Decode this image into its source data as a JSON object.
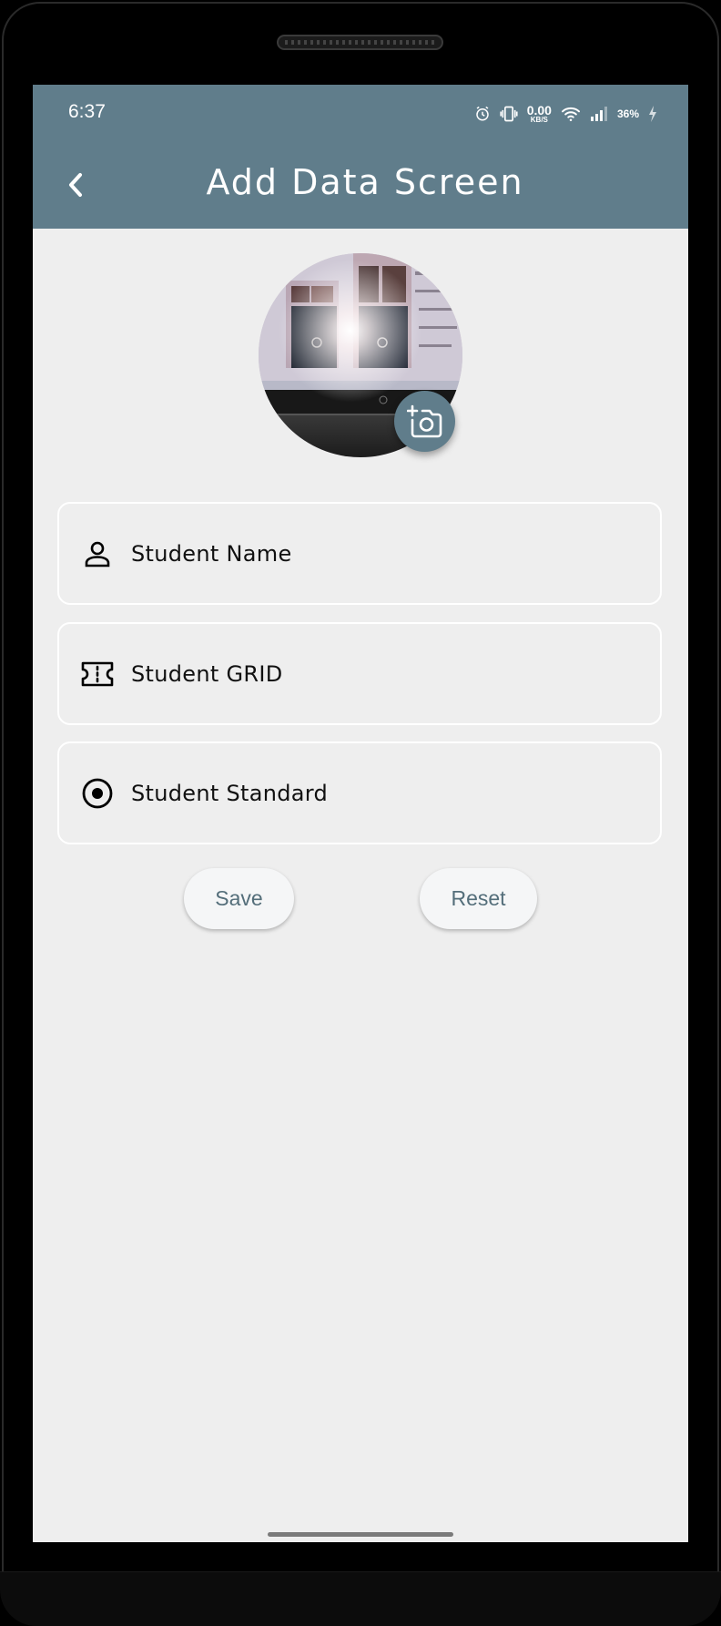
{
  "status_bar": {
    "time": "6:37",
    "net_speed_value": "0.00",
    "net_speed_unit": "KB/S",
    "battery": "36%",
    "icons": [
      "alarm-icon",
      "vibrate-icon",
      "wifi-icon",
      "signal-icon",
      "charging-icon"
    ]
  },
  "app_bar": {
    "title": "Add Data Screen",
    "back_icon": "chevron-left-icon",
    "background_color": "#607d8b"
  },
  "avatar": {
    "camera_icon": "add-photo-icon"
  },
  "form": {
    "fields": [
      {
        "icon": "person-icon",
        "placeholder": "Student Name"
      },
      {
        "icon": "ticket-icon",
        "placeholder": "Student GRID"
      },
      {
        "icon": "radio-button-checked-icon",
        "placeholder": "Student Standard"
      }
    ]
  },
  "buttons": {
    "save_label": "Save",
    "reset_label": "Reset",
    "text_color": "#546e7a"
  }
}
